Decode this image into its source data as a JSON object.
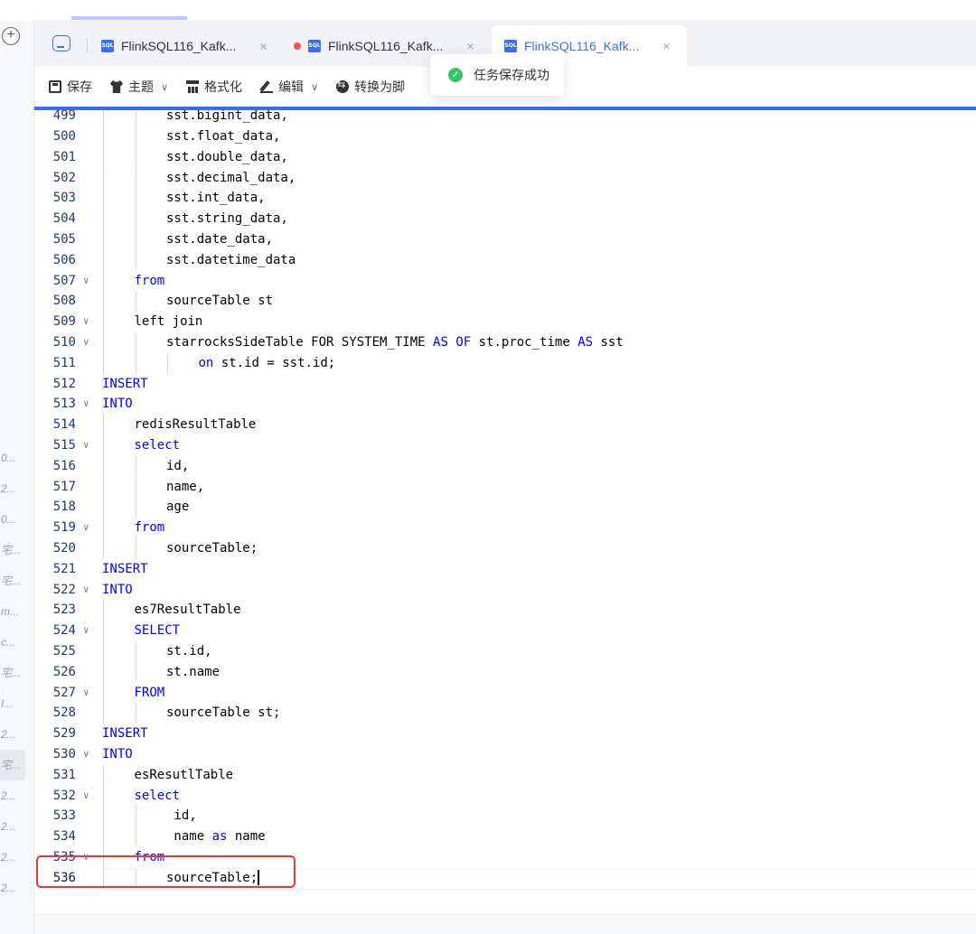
{
  "tabs": [
    {
      "label": "FlinkSQL116_Kafk...",
      "badge": "SQL",
      "active": false,
      "unsaved": false
    },
    {
      "label": "FlinkSQL116_Kafk...",
      "badge": "SQL",
      "active": false,
      "unsaved": true
    },
    {
      "label": "FlinkSQL116_Kafk...",
      "badge": "SQL",
      "active": true,
      "unsaved": false
    }
  ],
  "tab_close_glyph": "×",
  "add_glyph": "+",
  "toolbar": {
    "save": "保存",
    "theme": "主题",
    "format": "格式化",
    "edit": "编辑",
    "convert": "转换为脚"
  },
  "toast": {
    "message": "任务保存成功"
  },
  "sidebar_items": [
    "0...",
    "2...",
    "0...",
    "宅...",
    "宅...",
    "m...",
    "c...",
    "宅...",
    "I...",
    "2...",
    "宅...",
    "2...",
    "2...",
    "2...",
    "2..."
  ],
  "editor": {
    "current_line": 536,
    "lines": [
      {
        "n": 499,
        "indent": 2,
        "fold": false,
        "tokens": [
          [
            "t",
            "sst.bigint_data,"
          ]
        ],
        "partial": true
      },
      {
        "n": 500,
        "indent": 2,
        "fold": false,
        "tokens": [
          [
            "t",
            "sst.float_data,"
          ]
        ]
      },
      {
        "n": 501,
        "indent": 2,
        "fold": false,
        "tokens": [
          [
            "t",
            "sst.double_data,"
          ]
        ]
      },
      {
        "n": 502,
        "indent": 2,
        "fold": false,
        "tokens": [
          [
            "t",
            "sst.decimal_data,"
          ]
        ]
      },
      {
        "n": 503,
        "indent": 2,
        "fold": false,
        "tokens": [
          [
            "t",
            "sst.int_data,"
          ]
        ]
      },
      {
        "n": 504,
        "indent": 2,
        "fold": false,
        "tokens": [
          [
            "t",
            "sst.string_data,"
          ]
        ]
      },
      {
        "n": 505,
        "indent": 2,
        "fold": false,
        "tokens": [
          [
            "t",
            "sst.date_data,"
          ]
        ]
      },
      {
        "n": 506,
        "indent": 2,
        "fold": false,
        "tokens": [
          [
            "t",
            "sst.datetime_data"
          ]
        ]
      },
      {
        "n": 507,
        "indent": 1,
        "fold": true,
        "tokens": [
          [
            "k",
            "from"
          ]
        ]
      },
      {
        "n": 508,
        "indent": 2,
        "fold": false,
        "tokens": [
          [
            "t",
            "sourceTable st"
          ]
        ]
      },
      {
        "n": 509,
        "indent": 1,
        "fold": true,
        "tokens": [
          [
            "t",
            "left join"
          ]
        ]
      },
      {
        "n": 510,
        "indent": 2,
        "fold": true,
        "tokens": [
          [
            "t",
            "starrocksSideTable FOR SYSTEM_TIME "
          ],
          [
            "k",
            "AS"
          ],
          [
            "t",
            " "
          ],
          [
            "k",
            "OF"
          ],
          [
            "t",
            " st.proc_time "
          ],
          [
            "k",
            "AS"
          ],
          [
            "t",
            " sst"
          ]
        ]
      },
      {
        "n": 511,
        "indent": 3,
        "fold": false,
        "tokens": [
          [
            "k",
            "on"
          ],
          [
            "t",
            " st.id = sst.id;"
          ]
        ]
      },
      {
        "n": 512,
        "indent": 0,
        "fold": false,
        "tokens": [
          [
            "k",
            "INSERT"
          ]
        ]
      },
      {
        "n": 513,
        "indent": 0,
        "fold": true,
        "tokens": [
          [
            "k",
            "INTO"
          ]
        ]
      },
      {
        "n": 514,
        "indent": 1,
        "fold": false,
        "tokens": [
          [
            "t",
            "redisResultTable"
          ]
        ]
      },
      {
        "n": 515,
        "indent": 1,
        "fold": true,
        "tokens": [
          [
            "k",
            "select"
          ]
        ]
      },
      {
        "n": 516,
        "indent": 2,
        "fold": false,
        "tokens": [
          [
            "t",
            "id,"
          ]
        ]
      },
      {
        "n": 517,
        "indent": 2,
        "fold": false,
        "tokens": [
          [
            "t",
            "name,"
          ]
        ]
      },
      {
        "n": 518,
        "indent": 2,
        "fold": false,
        "tokens": [
          [
            "t",
            "age"
          ]
        ]
      },
      {
        "n": 519,
        "indent": 1,
        "fold": true,
        "tokens": [
          [
            "k",
            "from"
          ]
        ]
      },
      {
        "n": 520,
        "indent": 2,
        "fold": false,
        "tokens": [
          [
            "t",
            "sourceTable;"
          ]
        ]
      },
      {
        "n": 521,
        "indent": 0,
        "fold": false,
        "tokens": [
          [
            "k",
            "INSERT"
          ]
        ]
      },
      {
        "n": 522,
        "indent": 0,
        "fold": true,
        "tokens": [
          [
            "k",
            "INTO"
          ]
        ]
      },
      {
        "n": 523,
        "indent": 1,
        "fold": false,
        "tokens": [
          [
            "t",
            "es7ResultTable"
          ]
        ]
      },
      {
        "n": 524,
        "indent": 1,
        "fold": true,
        "tokens": [
          [
            "k",
            "SELECT"
          ]
        ]
      },
      {
        "n": 525,
        "indent": 2,
        "fold": false,
        "tokens": [
          [
            "t",
            "st.id,"
          ]
        ]
      },
      {
        "n": 526,
        "indent": 2,
        "fold": false,
        "tokens": [
          [
            "t",
            "st.name"
          ]
        ]
      },
      {
        "n": 527,
        "indent": 1,
        "fold": true,
        "tokens": [
          [
            "k",
            "FROM"
          ]
        ]
      },
      {
        "n": 528,
        "indent": 2,
        "fold": false,
        "tokens": [
          [
            "t",
            "sourceTable st;"
          ]
        ]
      },
      {
        "n": 529,
        "indent": 0,
        "fold": false,
        "tokens": [
          [
            "k",
            "INSERT"
          ]
        ]
      },
      {
        "n": 530,
        "indent": 0,
        "fold": true,
        "tokens": [
          [
            "k",
            "INTO"
          ]
        ]
      },
      {
        "n": 531,
        "indent": 1,
        "fold": false,
        "tokens": [
          [
            "t",
            "esResutlTable"
          ]
        ]
      },
      {
        "n": 532,
        "indent": 1,
        "fold": true,
        "tokens": [
          [
            "k",
            "select"
          ]
        ]
      },
      {
        "n": 533,
        "indent": 2,
        "fold": false,
        "tokens": [
          [
            "t",
            " id,"
          ]
        ]
      },
      {
        "n": 534,
        "indent": 2,
        "fold": false,
        "tokens": [
          [
            "t",
            " name "
          ],
          [
            "k",
            "as"
          ],
          [
            "t",
            " name"
          ]
        ]
      },
      {
        "n": 535,
        "indent": 1,
        "fold": true,
        "tokens": [
          [
            "k",
            "from"
          ]
        ]
      },
      {
        "n": 536,
        "indent": 2,
        "fold": false,
        "tokens": [
          [
            "t",
            "sourceTable;"
          ]
        ]
      }
    ]
  },
  "colors": {
    "accent": "#3b6df1",
    "keyword": "#0000ff",
    "highlight": "#e23a3a",
    "success": "#34c469"
  }
}
